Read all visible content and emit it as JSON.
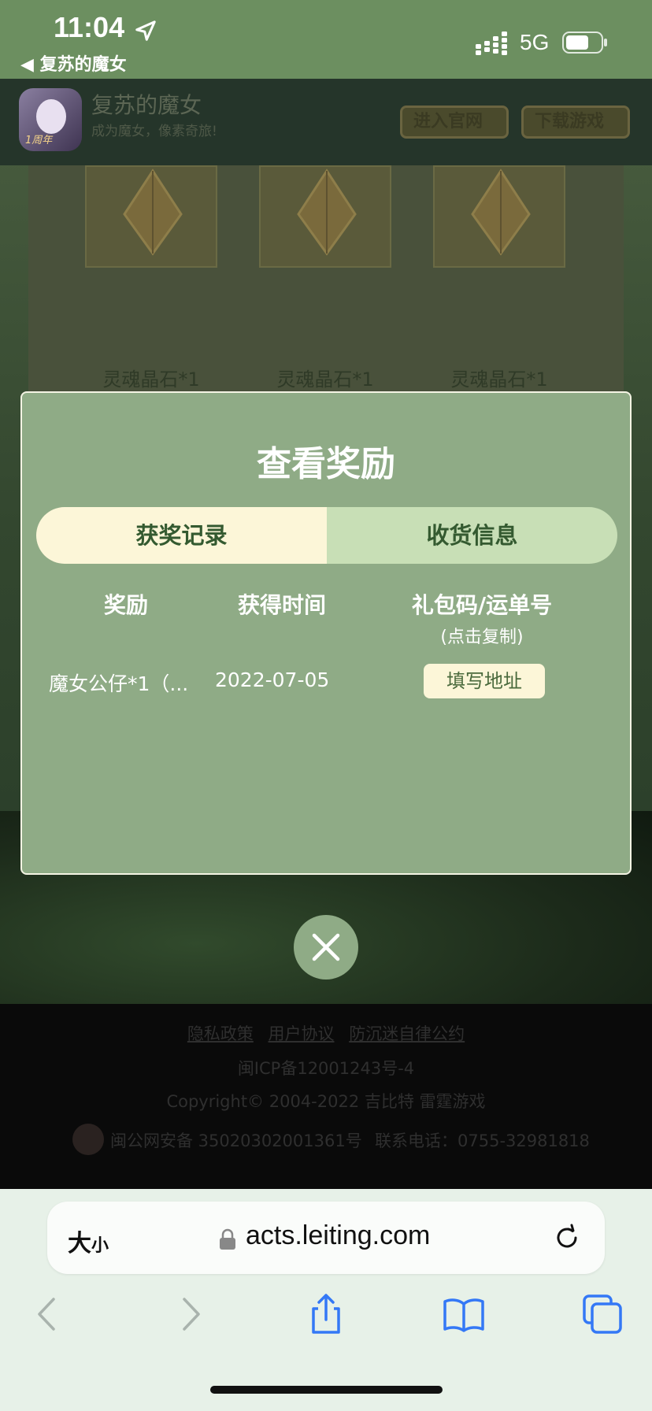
{
  "status_bar": {
    "time": "11:04",
    "back_label": "◀ 复苏的魔女",
    "network": "5G"
  },
  "page_header": {
    "app_title": "复苏的魔女",
    "app_subtitle": "成为魔女，像素奇旅!",
    "icon_badge": "1周年",
    "buttons": [
      "进入官网",
      "下载游戏"
    ]
  },
  "reward_grid": {
    "items": [
      "灵魂晶石*1",
      "灵魂晶石*1",
      "灵魂晶石*1"
    ]
  },
  "modal": {
    "title": "查看奖励",
    "tabs": [
      "获奖记录",
      "收货信息"
    ],
    "columns": [
      "奖励",
      "获得时间",
      "礼包码/运单号"
    ],
    "column_note": "(点击复制)",
    "records": [
      {
        "reward": "魔女公仔*1（...",
        "time": "2022-07-05",
        "action": "填写地址"
      }
    ]
  },
  "footer": {
    "links": [
      "隐私政策",
      "用户协议",
      "防沉迷自律公约"
    ],
    "icp": "闽ICP备12001243号-4",
    "copyright": "Copyright© 2004-2022  吉比特  雷霆游戏",
    "police_record": "闽公网安备 35020302001361号",
    "phone": "联系电话：0755-32981818"
  },
  "browser": {
    "text_size_label_big": "大",
    "text_size_label_small": "小",
    "url": "acts.leiting.com"
  },
  "colors": {
    "status_bar_bg": "#6c8f60",
    "modal_bg": "#8fab86",
    "tab_active_bg": "#fcf6d8",
    "tab_inactive_bg": "#c8dfb6",
    "toolbar_blue": "#3478f6"
  }
}
